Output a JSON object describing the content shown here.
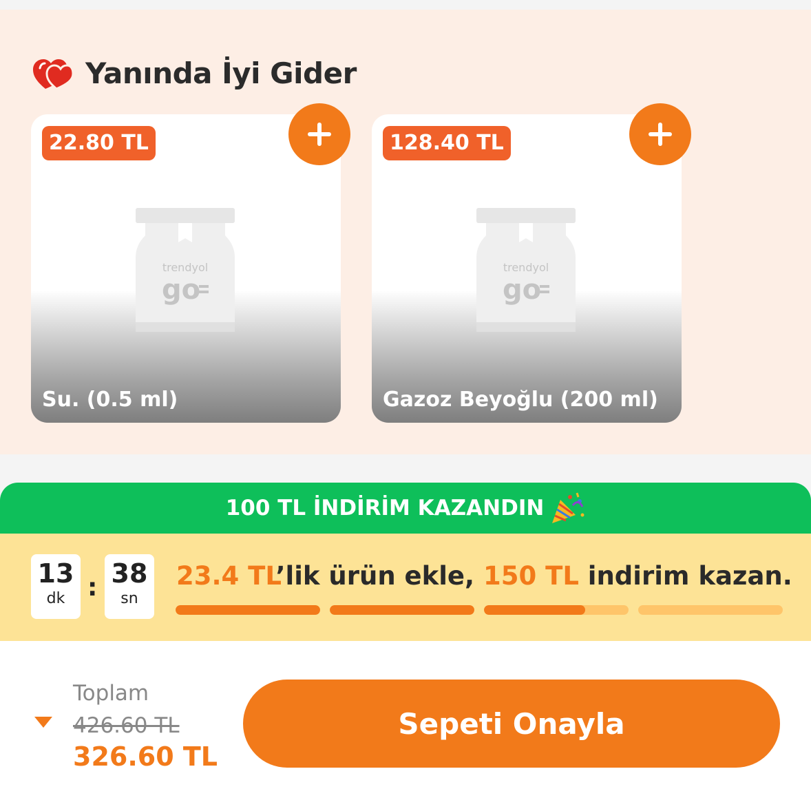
{
  "section": {
    "title": "Yanında İyi Gider"
  },
  "products": [
    {
      "price": "22.80 TL",
      "name": "Su. (0.5 ml)",
      "placeholder_logo": "trendyol go"
    },
    {
      "price": "128.40 TL",
      "name": "Gazoz Beyoğlu (200 ml)",
      "placeholder_logo": "trendyol go"
    }
  ],
  "promo": {
    "banner": "100 TL İNDİRİM KAZANDIN",
    "timer": {
      "minutes": "13",
      "minutes_unit": "dk",
      "seconds": "38",
      "seconds_unit": "sn"
    },
    "message": {
      "amount": "23.4 TL",
      "text1": "’lik ürün ekle, ",
      "discount": "150 TL",
      "text2": " indirim kazan."
    },
    "progress_segments": [
      1,
      1,
      0.7,
      0
    ]
  },
  "checkout": {
    "total_label": "Toplam",
    "old_total": "426.60 TL",
    "new_total": "326.60 TL",
    "confirm_label": "Sepeti Onayla"
  },
  "colors": {
    "accent": "#f27a1a",
    "price_badge": "#f0612a",
    "banner_green": "#0ebf5a",
    "timer_bg": "#fde396",
    "panel_bg": "#fdeee5"
  },
  "icons": [
    "heart-icon",
    "plus-icon",
    "party-popper-icon",
    "caret-down-icon"
  ]
}
